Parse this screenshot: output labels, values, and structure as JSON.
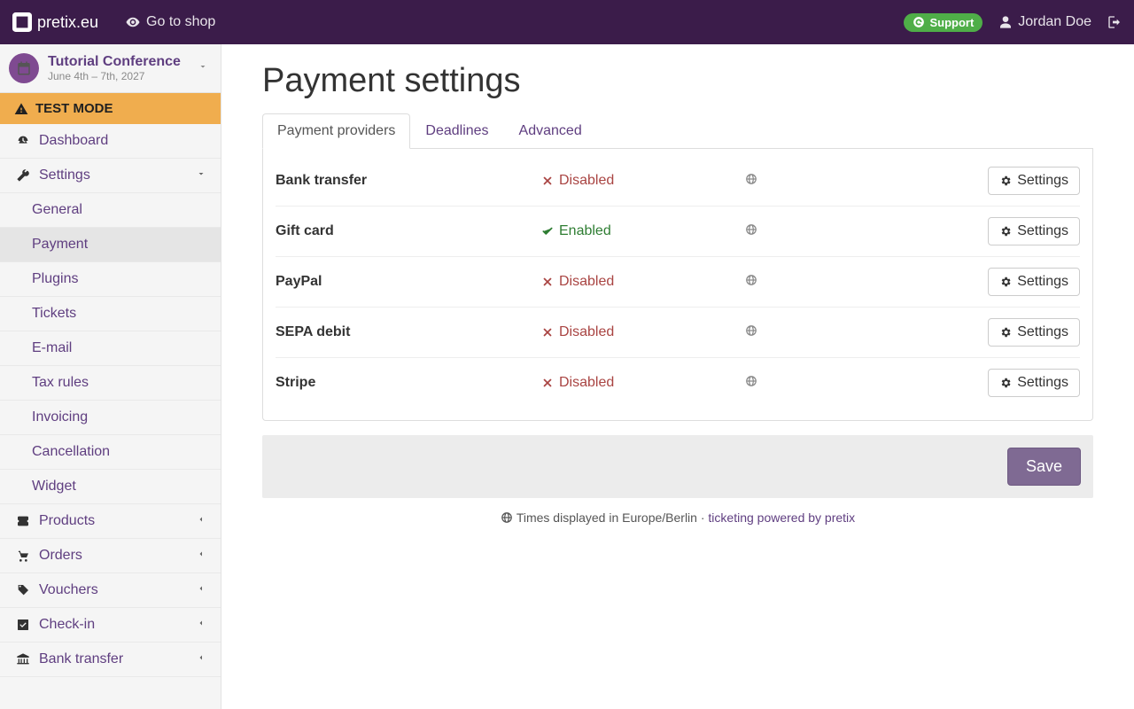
{
  "topnav": {
    "brand": "pretix.eu",
    "go_to_shop": "Go to shop",
    "support": "Support",
    "user": "Jordan Doe"
  },
  "event": {
    "title": "Tutorial Conference",
    "dates": "June 4th – 7th, 2027"
  },
  "sidebar": {
    "testmode": "TEST MODE",
    "dashboard": "Dashboard",
    "settings": {
      "label": "Settings",
      "items": {
        "general": "General",
        "payment": "Payment",
        "plugins": "Plugins",
        "tickets": "Tickets",
        "email": "E-mail",
        "taxrules": "Tax rules",
        "invoicing": "Invoicing",
        "cancellation": "Cancellation",
        "widget": "Widget"
      }
    },
    "products": "Products",
    "orders": "Orders",
    "vouchers": "Vouchers",
    "checkin": "Check-in",
    "banktransfer": "Bank transfer"
  },
  "page": {
    "title": "Payment settings",
    "tabs": {
      "providers": "Payment providers",
      "deadlines": "Deadlines",
      "advanced": "Advanced"
    },
    "status": {
      "enabled": "Enabled",
      "disabled": "Disabled"
    },
    "settings_btn": "Settings",
    "save": "Save",
    "providers": [
      {
        "name": "Bank transfer",
        "enabled": false
      },
      {
        "name": "Gift card",
        "enabled": true
      },
      {
        "name": "PayPal",
        "enabled": false
      },
      {
        "name": "SEPA debit",
        "enabled": false
      },
      {
        "name": "Stripe",
        "enabled": false
      }
    ]
  },
  "footer": {
    "tz": "Times displayed in Europe/Berlin",
    "sep": " · ",
    "credit": "ticketing powered by pretix"
  }
}
